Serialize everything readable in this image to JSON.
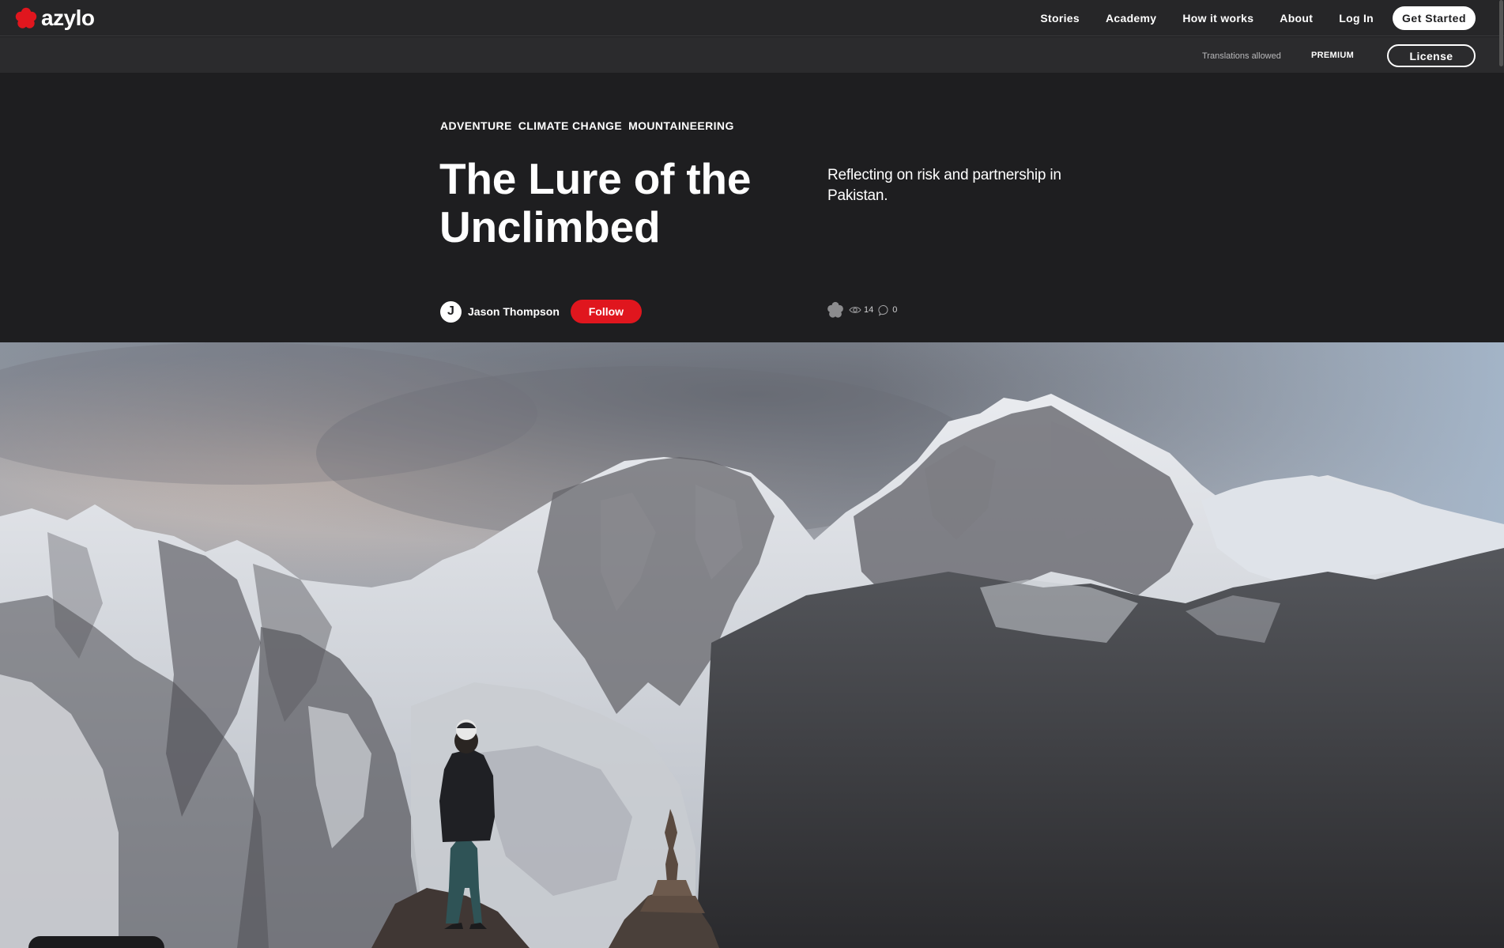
{
  "app": {
    "logo_text": "azylo",
    "brand_color": "#e0161e"
  },
  "nav": {
    "links": [
      "Stories",
      "Academy",
      "How it works",
      "About",
      "Log In"
    ],
    "cta": "Get Started"
  },
  "subbar": {
    "translations": "Translations allowed",
    "premium": "PREMIUM",
    "license": "License"
  },
  "article": {
    "tags": [
      "ADVENTURE",
      "CLIMATE CHANGE",
      "MOUNTAINEERING"
    ],
    "title": "The Lure of the Unclimbed",
    "subtitle": "Reflecting on risk and partnership in Pakistan.",
    "author": {
      "initial": "J",
      "name": "Jason Thompson",
      "follow_label": "Follow"
    },
    "stats": {
      "views": "14",
      "comments": "0"
    }
  },
  "icons": {
    "logo": "azylo-flower-icon",
    "reaction": "flower-icon",
    "views": "eye-icon",
    "comments": "comment-bubble-icon"
  }
}
